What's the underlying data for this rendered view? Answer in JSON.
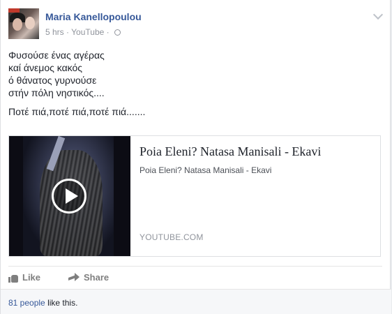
{
  "post": {
    "author": "Maria Kanellopoulou",
    "time": "5 hrs",
    "separator": "·",
    "source": "YouTube",
    "separator2": "·",
    "text_lines": [
      "Φυσούσε ένας αγέρας",
      "καί άνεμος κακός",
      "ό θάνατος γυρνούσε",
      "στήν πόλη νηστικός....",
      "Ποτέ πιά,ποτέ πιά,ποτέ πιά......."
    ]
  },
  "link": {
    "title": "Poia Eleni? Natasa Manisali - Ekavi",
    "description": "Poia Eleni? Natasa Manisali - Ekavi",
    "domain": "YOUTUBE.COM"
  },
  "actions": {
    "like": "Like",
    "share": "Share"
  },
  "likes": {
    "count": "81 people",
    "suffix": "like this."
  },
  "icons": [
    "chevron-down-icon",
    "globe-icon",
    "play-icon",
    "like-icon",
    "share-icon"
  ],
  "colors": {
    "link_blue": "#365899",
    "muted": "#90949c",
    "text": "#1d2129"
  }
}
